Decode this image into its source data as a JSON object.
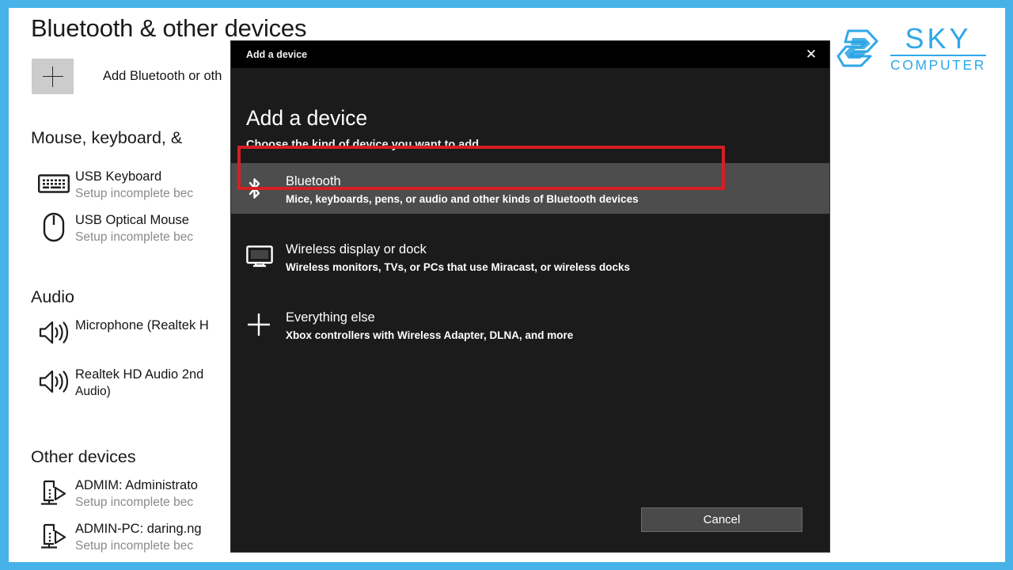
{
  "frame": {
    "accent_color": "#45b3e8"
  },
  "settings": {
    "page_title": "Bluetooth & other devices",
    "add_device_label": "Add Bluetooth or oth",
    "sections": [
      {
        "heading": "Mouse, keyboard, &",
        "items": [
          {
            "icon": "keyboard-icon",
            "name": "USB Keyboard",
            "sub": "Setup incomplete bec"
          },
          {
            "icon": "mouse-icon",
            "name": "USB Optical Mouse",
            "sub": "Setup incomplete bec"
          }
        ]
      },
      {
        "heading": "Audio",
        "items": [
          {
            "icon": "speaker-icon",
            "name": "Microphone (Realtek H",
            "sub": ""
          },
          {
            "icon": "speaker-icon",
            "name": "Realtek HD Audio 2nd",
            "sub": "Audio)"
          }
        ]
      },
      {
        "heading": "Other devices",
        "items": [
          {
            "icon": "network-device-icon",
            "name": "ADMIM: Administrato",
            "sub": "Setup incomplete bec"
          },
          {
            "icon": "network-device-icon",
            "name": "ADMIN-PC: daring.ng",
            "sub": "Setup incomplete bec"
          }
        ]
      }
    ]
  },
  "logo": {
    "mark": "sky-hexagon-icon",
    "primary": "SKY",
    "secondary": "COMPUTER",
    "color": "#2fa8e8"
  },
  "dialog": {
    "titlebar_text": "Add a device",
    "close_icon": "close-icon",
    "heading": "Add a device",
    "subheading": "Choose the kind of device you want to add.",
    "options": [
      {
        "icon": "bluetooth-icon",
        "title": "Bluetooth",
        "sub": "Mice, keyboards, pens, or audio and other kinds of Bluetooth devices",
        "selected": true,
        "highlighted": true
      },
      {
        "icon": "monitor-icon",
        "title": "Wireless display or dock",
        "sub": "Wireless monitors, TVs, or PCs that use Miracast, or wireless docks",
        "selected": false,
        "highlighted": false
      },
      {
        "icon": "plus-icon",
        "title": "Everything else",
        "sub": "Xbox controllers with Wireless Adapter, DLNA, and more",
        "selected": false,
        "highlighted": false
      }
    ],
    "cancel_label": "Cancel",
    "highlight_color": "#d51f23"
  }
}
